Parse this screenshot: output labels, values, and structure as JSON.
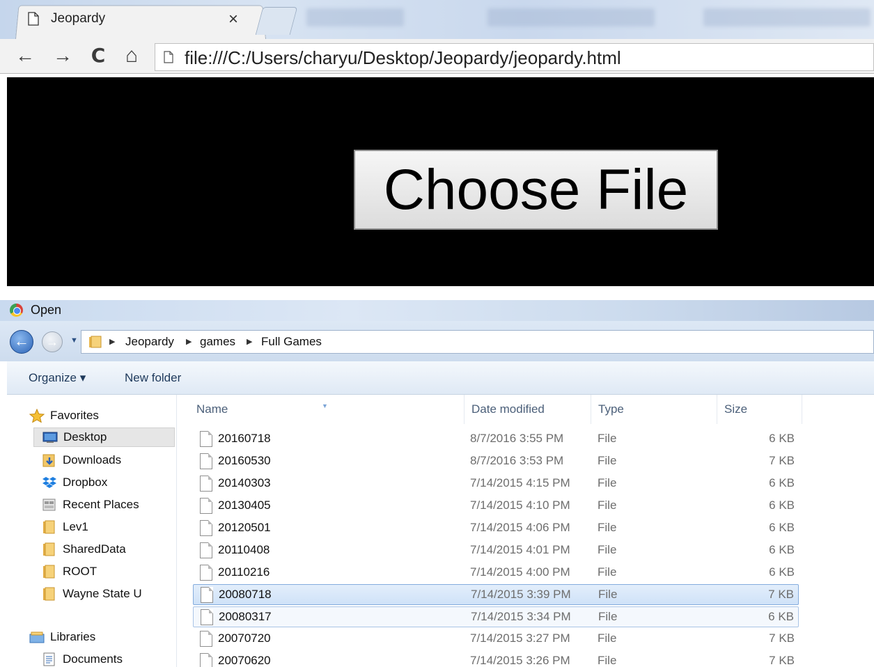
{
  "browser": {
    "tab_title": "Jeopardy",
    "tab_close": "×",
    "address": "file:///C:/Users/charyu/Desktop/Jeopardy/jeopardy.html",
    "nav": {
      "back": "←",
      "forward": "→",
      "reload": "C",
      "home": "⌂"
    }
  },
  "page": {
    "choose_file_label": "Choose File"
  },
  "dialog": {
    "title": "Open",
    "breadcrumb": [
      "Jeopardy",
      "games",
      "Full Games"
    ],
    "toolbar": {
      "organize": "Organize ▾",
      "new_folder": "New folder"
    },
    "nav_pane": {
      "favorites_label": "Favorites",
      "favorites": [
        "Desktop",
        "Downloads",
        "Dropbox",
        "Recent Places",
        "Lev1",
        "SharedData",
        "ROOT",
        "Wayne State U"
      ],
      "libraries_label": "Libraries",
      "libraries": [
        "Documents"
      ]
    },
    "columns": {
      "name": "Name",
      "date": "Date modified",
      "type": "Type",
      "size": "Size"
    },
    "files": [
      {
        "name": "20160718",
        "date": "8/7/2016 3:55 PM",
        "type": "File",
        "size": "6 KB"
      },
      {
        "name": "20160530",
        "date": "8/7/2016 3:53 PM",
        "type": "File",
        "size": "7 KB"
      },
      {
        "name": "20140303",
        "date": "7/14/2015 4:15 PM",
        "type": "File",
        "size": "6 KB"
      },
      {
        "name": "20130405",
        "date": "7/14/2015 4:10 PM",
        "type": "File",
        "size": "6 KB"
      },
      {
        "name": "20120501",
        "date": "7/14/2015 4:06 PM",
        "type": "File",
        "size": "6 KB"
      },
      {
        "name": "20110408",
        "date": "7/14/2015 4:01 PM",
        "type": "File",
        "size": "6 KB"
      },
      {
        "name": "20110216",
        "date": "7/14/2015 4:00 PM",
        "type": "File",
        "size": "6 KB"
      },
      {
        "name": "20080718",
        "date": "7/14/2015 3:39 PM",
        "type": "File",
        "size": "7 KB"
      },
      {
        "name": "20080317",
        "date": "7/14/2015 3:34 PM",
        "type": "File",
        "size": "6 KB"
      },
      {
        "name": "20070720",
        "date": "7/14/2015 3:27 PM",
        "type": "File",
        "size": "7 KB"
      },
      {
        "name": "20070620",
        "date": "7/14/2015 3:26 PM",
        "type": "File",
        "size": "7 KB"
      }
    ],
    "selected_file": "20080718"
  }
}
